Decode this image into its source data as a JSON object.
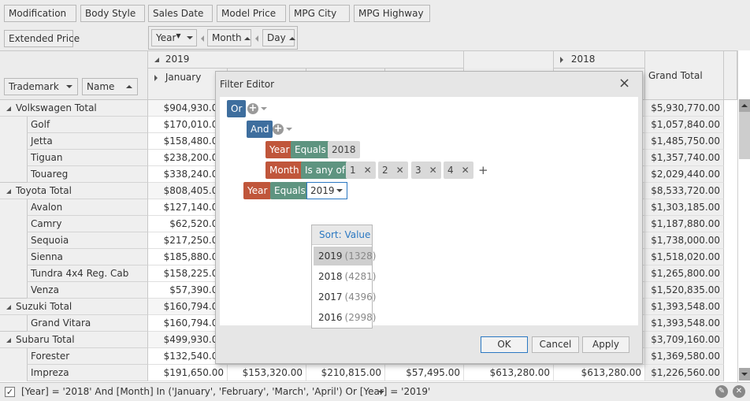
{
  "field_list": {
    "row1": [
      "Modification",
      "Body Style",
      "Sales Date",
      "Model Price",
      "MPG City",
      "MPG Highway"
    ],
    "row2": [
      "Extended Price"
    ]
  },
  "column_fields": [
    {
      "label": "Year",
      "has_filter": true,
      "sort": "desc"
    },
    {
      "label": "Month",
      "sort": "asc"
    },
    {
      "label": "Day",
      "sort": "asc"
    }
  ],
  "row_fields": [
    {
      "label": "Trademark",
      "sort": "desc"
    },
    {
      "label": "Name",
      "sort": "asc"
    }
  ],
  "column_headers": {
    "year_2019": "2019",
    "year_2018": "2018",
    "month_january": "January",
    "grand_total": "Grand Total"
  },
  "rows": [
    {
      "label": "Volkswagen Total",
      "type": "total",
      "first": "$904,930.00",
      "grand": "$5,930,770.00"
    },
    {
      "label": "Golf",
      "type": "item",
      "first": "$170,010.00",
      "grand": "$1,057,840.00"
    },
    {
      "label": "Jetta",
      "type": "item",
      "first": "$158,480.00",
      "grand": "$1,485,750.00"
    },
    {
      "label": "Tiguan",
      "type": "item",
      "first": "$238,200.00",
      "grand": "$1,357,740.00"
    },
    {
      "label": "Touareg",
      "type": "item",
      "first": "$338,240.00",
      "grand": "$2,029,440.00"
    },
    {
      "label": "Toyota Total",
      "type": "total",
      "first": "$808,405.00",
      "grand": "$8,533,720.00"
    },
    {
      "label": "Avalon",
      "type": "item",
      "first": "$127,140.00",
      "grand": "$1,303,185.00"
    },
    {
      "label": "Camry",
      "type": "item",
      "first": "$62,520.00",
      "grand": "$1,187,880.00"
    },
    {
      "label": "Sequoia",
      "type": "item",
      "first": "$217,250.00",
      "grand": "$1,738,000.00"
    },
    {
      "label": "Sienna",
      "type": "item",
      "first": "$185,880.00",
      "grand": "$1,518,020.00"
    },
    {
      "label": "Tundra 4x4 Reg. Cab",
      "type": "item",
      "first": "$158,225.00",
      "grand": "$1,265,800.00"
    },
    {
      "label": "Venza",
      "type": "item",
      "first": "$57,390.00",
      "grand": "$1,520,835.00"
    },
    {
      "label": "Suzuki Total",
      "type": "total",
      "first": "$160,794.00",
      "grand": "$1,393,548.00"
    },
    {
      "label": "Grand Vitara",
      "type": "item",
      "first": "$160,794.00",
      "grand": "$1,393,548.00"
    },
    {
      "label": "Subaru Total",
      "type": "total",
      "first": "$499,930.00",
      "grand": "$3,709,160.00"
    },
    {
      "label": "Forester",
      "type": "item",
      "first": "$132,540.00",
      "grand": "$1,369,580.00"
    },
    {
      "label": "Impreza",
      "type": "item",
      "first": "$191,650.00",
      "grand": "$1,226,560.00",
      "cells": [
        "$191,650.00",
        "$153,320.00",
        "$210,815.00",
        "$57,495.00",
        "$613,280.00",
        "$613,280.00"
      ]
    }
  ],
  "filter_editor": {
    "title": "Filter Editor",
    "close_label": "×",
    "root_group": "Or",
    "sub_group": "And",
    "conditions": [
      {
        "field": "Year",
        "op": "Equals",
        "values": [
          "2018"
        ]
      },
      {
        "field": "Month",
        "op": "Is any of",
        "values": [
          "1",
          "2",
          "3",
          "4"
        ]
      },
      {
        "field": "Year",
        "op": "Equals",
        "value_edit": "2019"
      }
    ],
    "dropdown": {
      "sort_label": "Sort: Value",
      "items": [
        {
          "value": "2019",
          "count": "(1328)",
          "selected": true
        },
        {
          "value": "2018",
          "count": "(4281)"
        },
        {
          "value": "2017",
          "count": "(4396)"
        },
        {
          "value": "2016",
          "count": "(2998)"
        }
      ]
    },
    "buttons": {
      "ok": "OK",
      "cancel": "Cancel",
      "apply": "Apply"
    }
  },
  "status_bar": {
    "filter_enabled": true,
    "filter_text": "[Year] = '2018' And [Month] In ('January', 'February', 'March', 'April') Or [Year] = '2019'"
  },
  "colors": {
    "group_token": "#3e6e9e",
    "field_token": "#c0563b",
    "operator_token": "#5e9480",
    "value_token": "#d9d9d9",
    "accent": "#2b78c2"
  }
}
